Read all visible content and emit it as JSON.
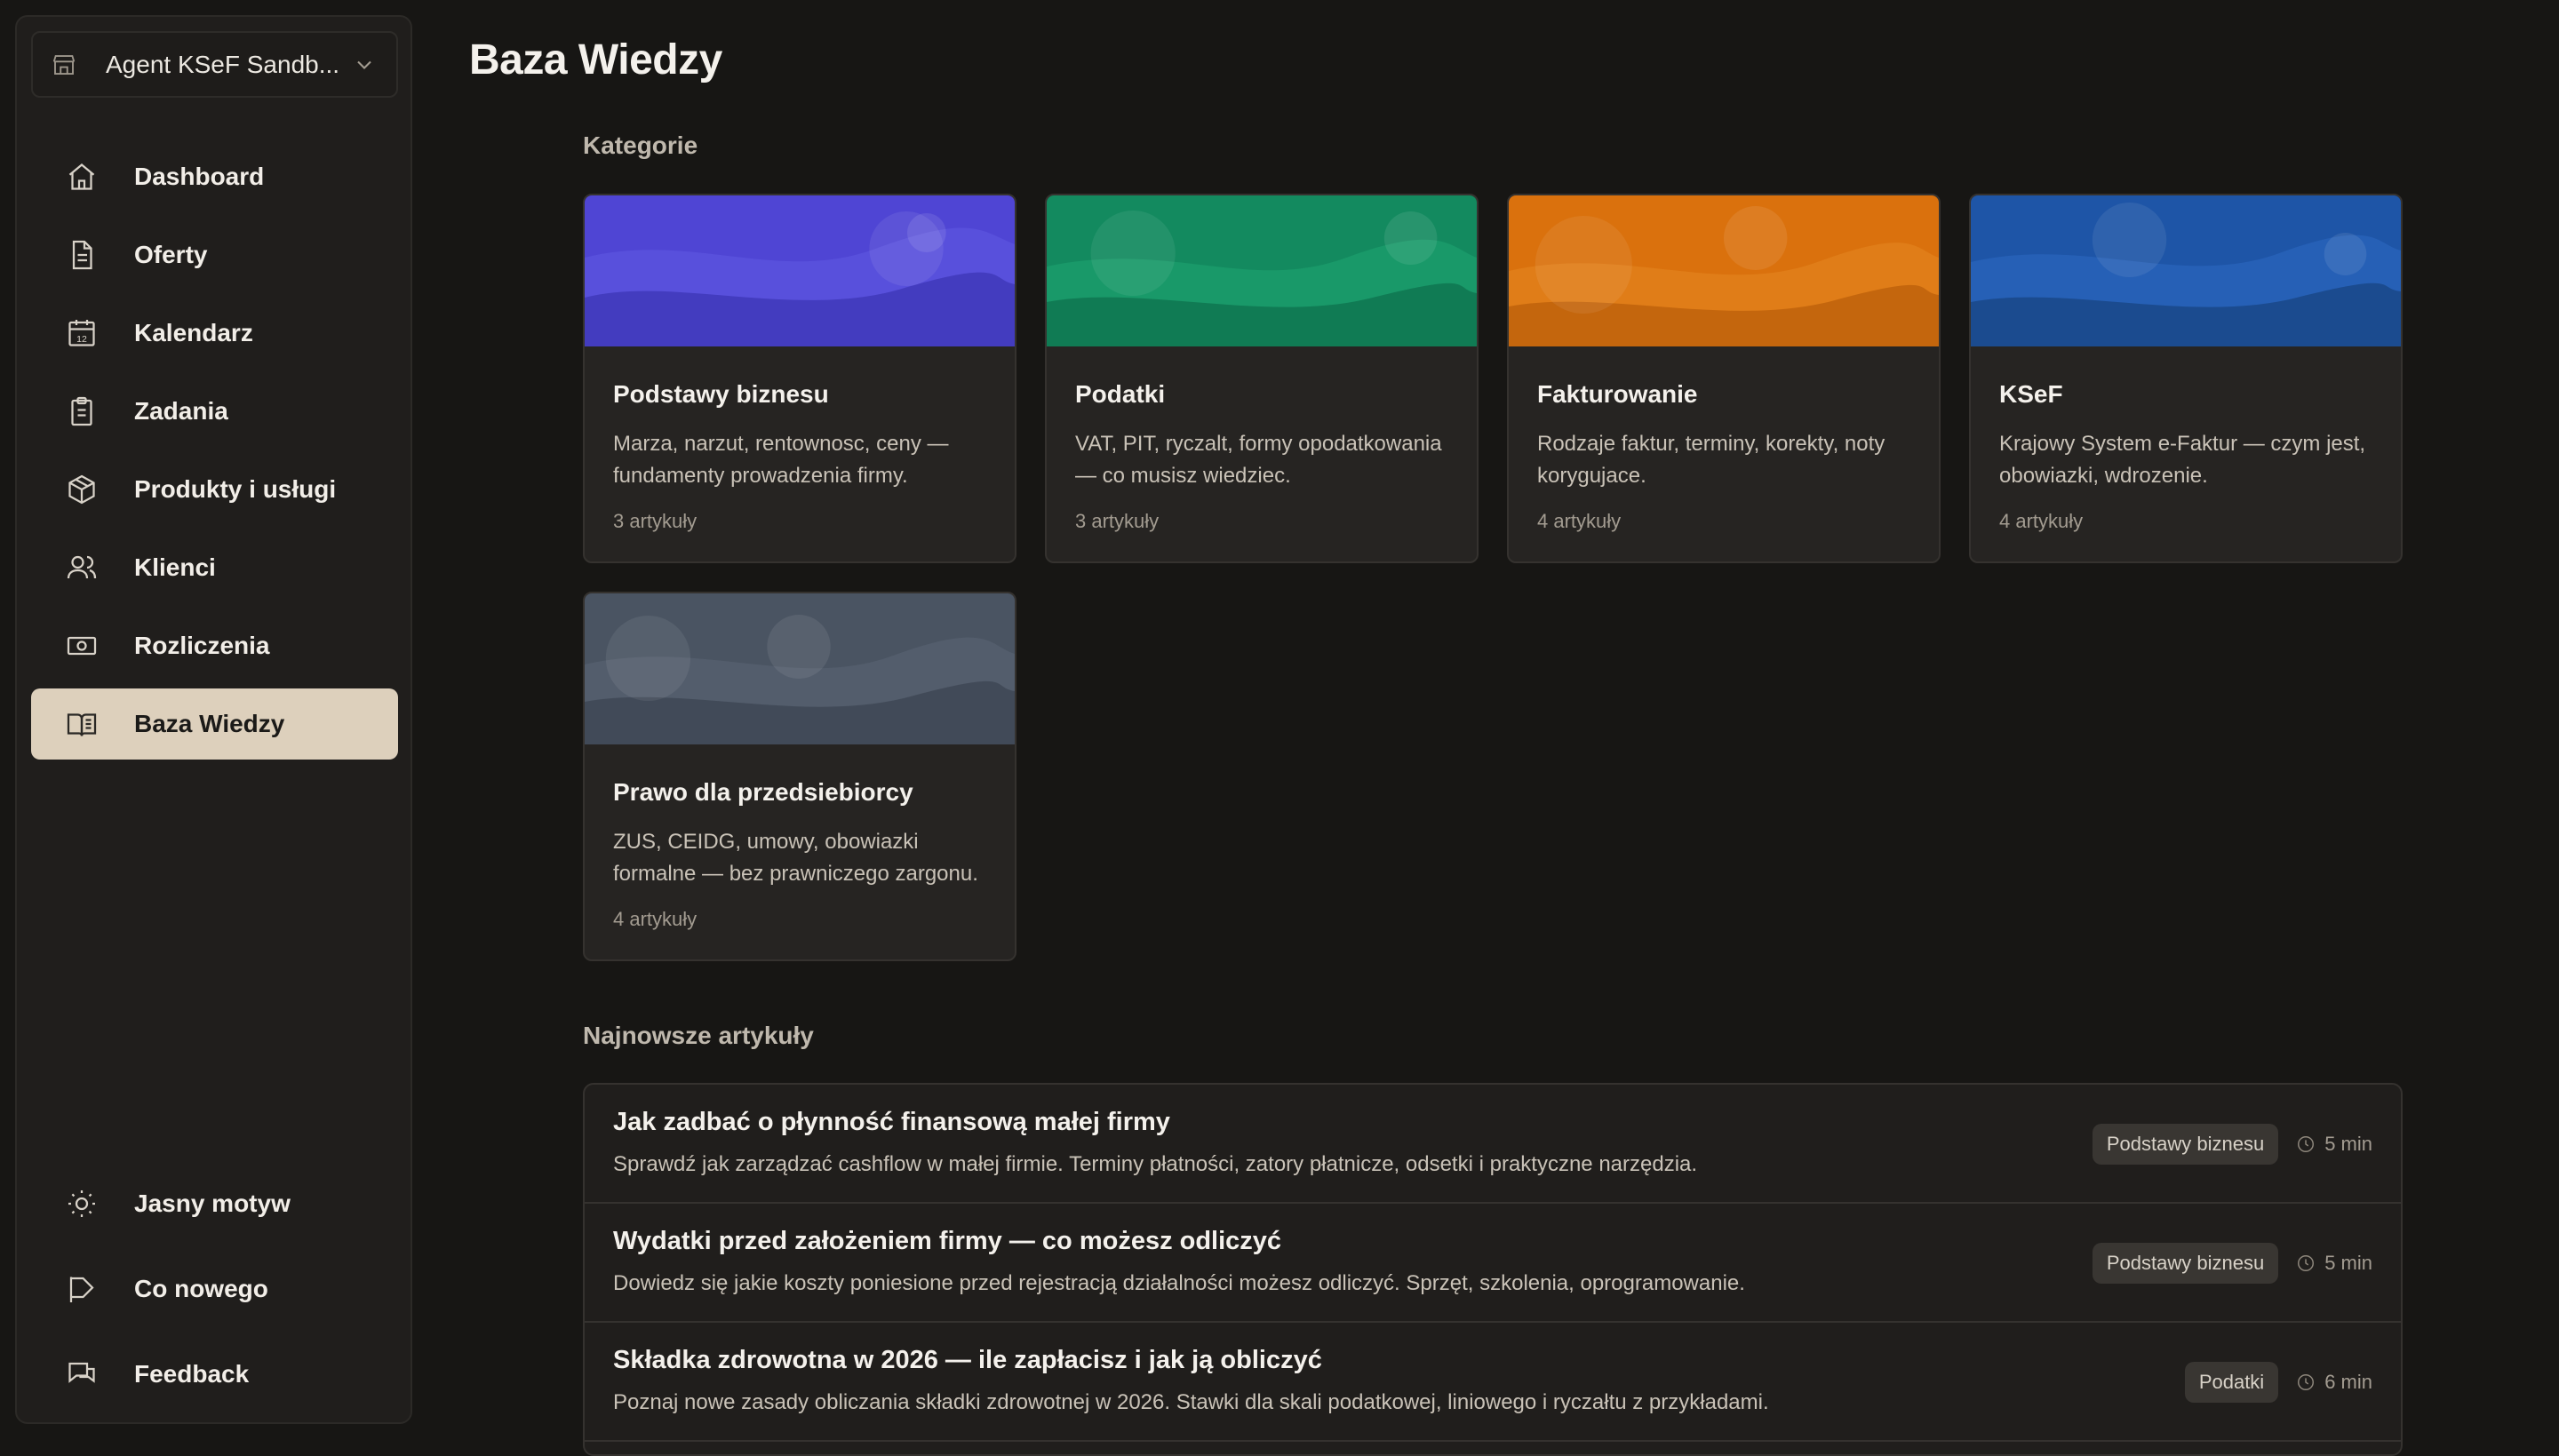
{
  "sidebar": {
    "workspace": {
      "name": "Agent KSeF Sandb..."
    },
    "items": [
      {
        "label": "Dashboard",
        "icon": "home-icon"
      },
      {
        "label": "Oferty",
        "icon": "document-icon"
      },
      {
        "label": "Kalendarz",
        "icon": "calendar-icon",
        "icon_text": "12"
      },
      {
        "label": "Zadania",
        "icon": "clipboard-icon"
      },
      {
        "label": "Produkty i usługi",
        "icon": "box-icon"
      },
      {
        "label": "Klienci",
        "icon": "users-icon"
      },
      {
        "label": "Rozliczenia",
        "icon": "banknote-icon"
      },
      {
        "label": "Baza Wiedzy",
        "icon": "book-icon",
        "active": true
      }
    ],
    "bottom": [
      {
        "label": "Jasny motyw",
        "icon": "sun-icon"
      },
      {
        "label": "Co nowego",
        "icon": "flag-icon"
      },
      {
        "label": "Feedback",
        "icon": "chat-icon"
      }
    ]
  },
  "main": {
    "title": "Baza Wiedzy",
    "categories_label": "Kategorie",
    "categories": [
      {
        "title": "Podstawy biznesu",
        "description": "Marza, narzut, rentownosc, ceny — fundamenty prowadzenia firmy.",
        "count": "3 artykuły",
        "color": "#5046d6"
      },
      {
        "title": "Podatki",
        "description": "VAT, PIT, ryczalt, formy opodatkowania — co musisz wiedziec.",
        "count": "3 artykuły",
        "color": "#12895e"
      },
      {
        "title": "Fakturowanie",
        "description": "Rodzaje faktur, terminy, korekty, noty korygujace.",
        "count": "4 artykuły",
        "color": "#d9700c"
      },
      {
        "title": "KSeF",
        "description": "Krajowy System e-Faktur — czym jest, obowiazki, wdrozenie.",
        "count": "4 artykuły",
        "color": "#1f56a8"
      },
      {
        "title": "Prawo dla przedsiebiorcy",
        "description": "ZUS, CEIDG, umowy, obowiazki formalne — bez prawniczego zargonu.",
        "count": "4 artykuły",
        "color": "#4a5563"
      }
    ],
    "articles_label": "Najnowsze artykuły",
    "articles": [
      {
        "title": "Jak zadbać o płynność finansową małej firmy",
        "description": "Sprawdź jak zarządzać cashflow w małej firmie. Terminy płatności, zatory płatnicze, odsetki i praktyczne narzędzia.",
        "category": "Podstawy biznesu",
        "time": "5 min"
      },
      {
        "title": "Wydatki przed założeniem firmy — co możesz odliczyć",
        "description": "Dowiedz się jakie koszty poniesione przed rejestracją działalności możesz odliczyć. Sprzęt, szkolenia, oprogramowanie.",
        "category": "Podstawy biznesu",
        "time": "5 min"
      },
      {
        "title": "Składka zdrowotna w 2026 — ile zapłacisz i jak ją obliczyć",
        "description": "Poznaj nowe zasady obliczania składki zdrowotnej w 2026. Stawki dla skali podatkowej, liniowego i ryczałtu z przykładami.",
        "category": "Podatki",
        "time": "6 min"
      }
    ]
  }
}
